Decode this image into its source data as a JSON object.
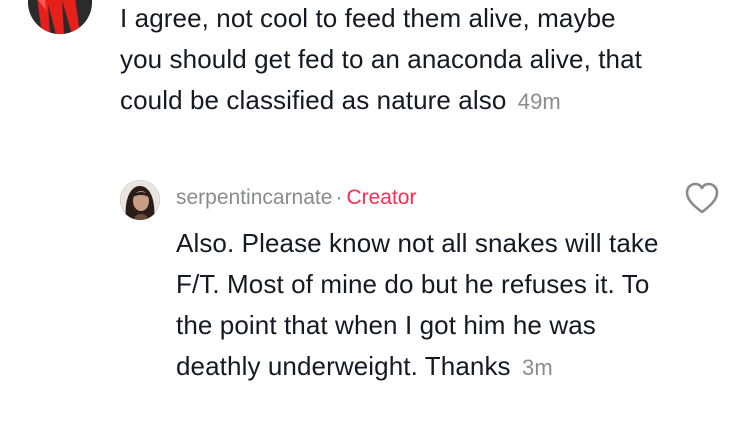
{
  "parent_comment": {
    "text": "I agree, not cool to feed them alive, maybe you should get fed to an anaconda alive, that could be classified as nature also",
    "timestamp": "49m"
  },
  "reply": {
    "username": "serpentincarnate",
    "separator": "·",
    "creator_label": "Creator",
    "text": "Also. Please know not all snakes will take F/T. Most of mine do but he refuses it. To the point that when I got him he was deathly underweight. Thanks",
    "timestamp": "3m"
  },
  "colors": {
    "text": "#161823",
    "muted": "#8a8b91",
    "creator": "#fe2c55",
    "avatar_red": "#e8201c"
  },
  "icons": {
    "like": "heart-outline-icon",
    "parent_like": "heart-outline-icon"
  }
}
